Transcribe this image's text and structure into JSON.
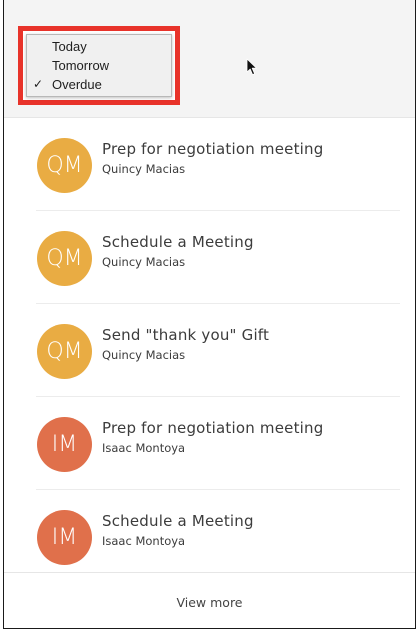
{
  "filter_menu": {
    "items": [
      {
        "label": "Today",
        "checked": false
      },
      {
        "label": "Tomorrow",
        "checked": false
      },
      {
        "label": "Overdue",
        "checked": true
      }
    ],
    "check_mark": "✓",
    "highlight_color": "#e8332a"
  },
  "tasks": [
    {
      "title": "Prep for negotiation meeting",
      "person": "Quincy Macias",
      "initials": "QM",
      "avatar_color": "#e9ac43"
    },
    {
      "title": "Schedule a Meeting",
      "person": "Quincy Macias",
      "initials": "QM",
      "avatar_color": "#e9ac43"
    },
    {
      "title": "Send \"thank you\" Gift",
      "person": "Quincy Macias",
      "initials": "QM",
      "avatar_color": "#e9ac43"
    },
    {
      "title": "Prep for negotiation meeting",
      "person": "Isaac Montoya",
      "initials": "IM",
      "avatar_color": "#e0704b"
    },
    {
      "title": "Schedule a Meeting",
      "person": "Isaac Montoya",
      "initials": "IM",
      "avatar_color": "#e0704b"
    }
  ],
  "footer": {
    "view_more_label": "View more"
  },
  "icons": {
    "cursor": "mouse-pointer-icon"
  }
}
